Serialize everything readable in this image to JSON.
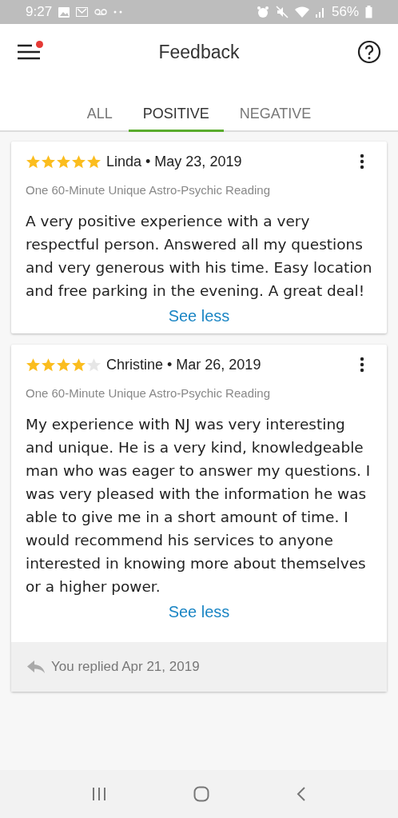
{
  "status_bar": {
    "time": "9:27",
    "battery": "56%"
  },
  "app_bar": {
    "title": "Feedback",
    "menu_badge": true
  },
  "tabs": [
    {
      "label": "ALL",
      "selected": false
    },
    {
      "label": "POSITIVE",
      "selected": true
    },
    {
      "label": "NEGATIVE",
      "selected": false
    }
  ],
  "reviews": [
    {
      "stars": 5,
      "byline": "Linda • May 23, 2019",
      "product": "One 60-Minute Unique Astro-Psychic Reading",
      "text": "A very positive experience with a very respectful person. Answered all my questions and very generous with his time. Easy location and free parking in the evening. A great deal!",
      "link": "See less"
    },
    {
      "stars": 4,
      "byline": "Christine • Mar 26, 2019",
      "product": "One 60-Minute Unique Astro-Psychic Reading",
      "text": "My experience with NJ was very interesting and unique. He is a very kind, knowledgeable man who was eager to answer my questions. I was very pleased with the information he was able to give me in a short amount of time. I would recommend his services to anyone interested in knowing more about themselves or a higher power.",
      "link": "See less",
      "reply": "You replied Apr 21, 2019"
    }
  ]
}
